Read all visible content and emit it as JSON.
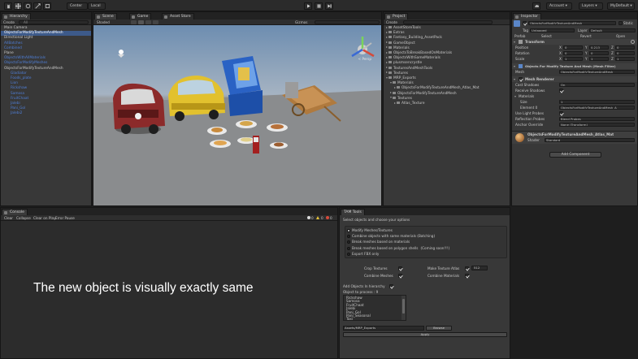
{
  "toolbar": {
    "pivot_label": "Center",
    "space_label": "Local",
    "account_label": "Account",
    "layers_label": "Layers",
    "layout_label": "MyDefault"
  },
  "hierarchy": {
    "tab_label": "Hierarchy",
    "create_label": "Create",
    "search_placeholder": "All",
    "items": [
      {
        "label": "Main Camera",
        "style": "normal",
        "indent": 0
      },
      {
        "label": "ObjectsForModifyTextureAndMesh",
        "style": "selected",
        "indent": 0
      },
      {
        "label": "Directional Light",
        "style": "normal",
        "indent": 0
      },
      {
        "label": "AllBatches",
        "style": "blue",
        "indent": 0
      },
      {
        "label": "Combined",
        "style": "blue",
        "indent": 0
      },
      {
        "label": "Plane",
        "style": "normal",
        "indent": 0
      },
      {
        "label": "ObjectsWithAllMaterials",
        "style": "blue",
        "indent": 0
      },
      {
        "label": "ObjectsForModifyMeshes",
        "style": "blue",
        "indent": 0
      },
      {
        "label": "ObjectsForModifyTextureAndMesh",
        "style": "normal",
        "indent": 0
      },
      {
        "label": "Gladiator",
        "style": "blue",
        "indent": 2
      },
      {
        "label": "Foods_plate",
        "style": "blue",
        "indent": 2
      },
      {
        "label": "Lion",
        "style": "blue",
        "indent": 2
      },
      {
        "label": "Rickshaw",
        "style": "blue",
        "indent": 2
      },
      {
        "label": "Samosa",
        "style": "blue",
        "indent": 2
      },
      {
        "label": "FruitChaat",
        "style": "blue",
        "indent": 2
      },
      {
        "label": "Jalebi",
        "style": "blue",
        "indent": 2
      },
      {
        "label": "Pani_Gol",
        "style": "blue",
        "indent": 2
      },
      {
        "label": "Jalebi2",
        "style": "blue",
        "indent": 2
      }
    ]
  },
  "scene": {
    "tabs": [
      "Scene",
      "Game",
      "Asset Store"
    ],
    "shading_label": "Shaded",
    "gizmos_label": "Gizmos",
    "persp_label": "< Persp"
  },
  "project": {
    "tab_label": "Project",
    "create_label": "Create",
    "items": [
      {
        "label": "AssetStoreTools",
        "depth": 0,
        "open": false
      },
      {
        "label": "Extras",
        "depth": 0,
        "open": false
      },
      {
        "label": "Fantasy_Building_AssetPack",
        "depth": 0,
        "open": false
      },
      {
        "label": "GameObject",
        "depth": 0,
        "open": false
      },
      {
        "label": "Materials",
        "depth": 0,
        "open": false
      },
      {
        "label": "ObjectsToBreakBasedOnMaterials",
        "depth": 0,
        "open": false
      },
      {
        "label": "ObjectsWithSameMaterials",
        "depth": 0,
        "open": false
      },
      {
        "label": "plusmsencrystle",
        "depth": 0,
        "open": false
      },
      {
        "label": "TexturesAndMeshTools",
        "depth": 0,
        "open": false
      },
      {
        "label": "Textures",
        "depth": 0,
        "open": false
      },
      {
        "label": "MRP_Exports",
        "depth": 0,
        "open": true
      },
      {
        "label": "Materials",
        "depth": 1,
        "open": true
      },
      {
        "label": "ObjectsForModifyTextureAndMesh_Atlas_Mat",
        "depth": 2,
        "open": false
      },
      {
        "label": "ObjectsForModifyTextureAndMesh",
        "depth": 1,
        "open": false
      },
      {
        "label": "Textures",
        "depth": 1,
        "open": true
      },
      {
        "label": "Atlas_Texture",
        "depth": 2,
        "open": false
      }
    ]
  },
  "inspector": {
    "tab_label": "Inspector",
    "object_name": "ObjectsForModifyTextureAndMesh",
    "static_label": "Static",
    "tag_label": "Tag",
    "tag_value": "Untagged",
    "layer_label": "Layer",
    "layer_value": "Default",
    "prefab_label": "Prefab",
    "prefab_select": "Select",
    "prefab_revert": "Revert",
    "prefab_open": "Open",
    "transform_title": "Transform",
    "position_label": "Position",
    "position": {
      "x": "0",
      "y": "0.213",
      "z": "0"
    },
    "rotation_label": "Rotation",
    "rotation": {
      "x": "0",
      "y": "0",
      "z": "0"
    },
    "scale_label": "Scale",
    "scale": {
      "x": "1",
      "y": "1",
      "z": "1"
    },
    "meshfilter_title": "Objects For Modify Texture And Mesh (Mesh Filter)",
    "mesh_label": "Mesh",
    "mesh_value": "ObjectsForModifyTextureAndMesh",
    "meshrenderer_title": "Mesh Renderer",
    "cast_shadows_label": "Cast Shadows",
    "cast_shadows_value": "On",
    "receive_shadows_label": "Receive Shadows",
    "materials_label": "Materials",
    "size_label": "Size",
    "size_value": "1",
    "element0_label": "Element 0",
    "element0_value": "ObjectsForModifyTextureAndMesh_A",
    "light_probes_label": "Use Light Probes",
    "reflection_probes_label": "Reflection Probes",
    "reflection_probes_value": "Blend Probes",
    "anchor_override_label": "Anchor Override",
    "anchor_override_value": "None (Transform)",
    "material_name": "ObjectsForModifyTextureAndMesh_Atlas_Mat",
    "shader_label": "Shader",
    "shader_value": "Standard",
    "add_component_label": "Add Component"
  },
  "console": {
    "tab_label": "Console",
    "buttons": [
      "Clear",
      "Collapse",
      "Clear on Play",
      "Error Pause"
    ],
    "counts": [
      "0",
      "0",
      "0"
    ]
  },
  "tam_tools": {
    "tab_label": "TAM Tools",
    "instruction": "Select objects and choose your options",
    "options": [
      {
        "label": "Modify Meshes/Textures",
        "selected": true
      },
      {
        "label": "Combine objects with same materials (Batching)",
        "selected": false
      },
      {
        "label": "Break meshes based on materials",
        "selected": false
      },
      {
        "label": "Break meshes based on polygon shells",
        "selected": false,
        "note": "(Coming soon!!!)"
      },
      {
        "label": "Export FBX only",
        "selected": false
      }
    ],
    "crop_textures_label": "Crop Textures",
    "make_texture_atlas_label": "Make Texture Atlas",
    "atlas_size_value": "512",
    "combine_meshes_label": "Combine Meshes",
    "combine_materials_label": "Combine Materials",
    "add_objects_label": "Add Objects In hierarchy",
    "objects_to_process_label": "Object to process : 9",
    "object_list": [
      "Rickshaw",
      "Samosa",
      "FruitChaat",
      "Jalebi",
      "Pani_Gol",
      "Pani_Seasonal",
      "Taxi"
    ],
    "export_path": "Assets/MRP_Exports",
    "browse_label": "Browse",
    "apply_label": "Apply"
  },
  "caption": "The new object is visually exactly same"
}
